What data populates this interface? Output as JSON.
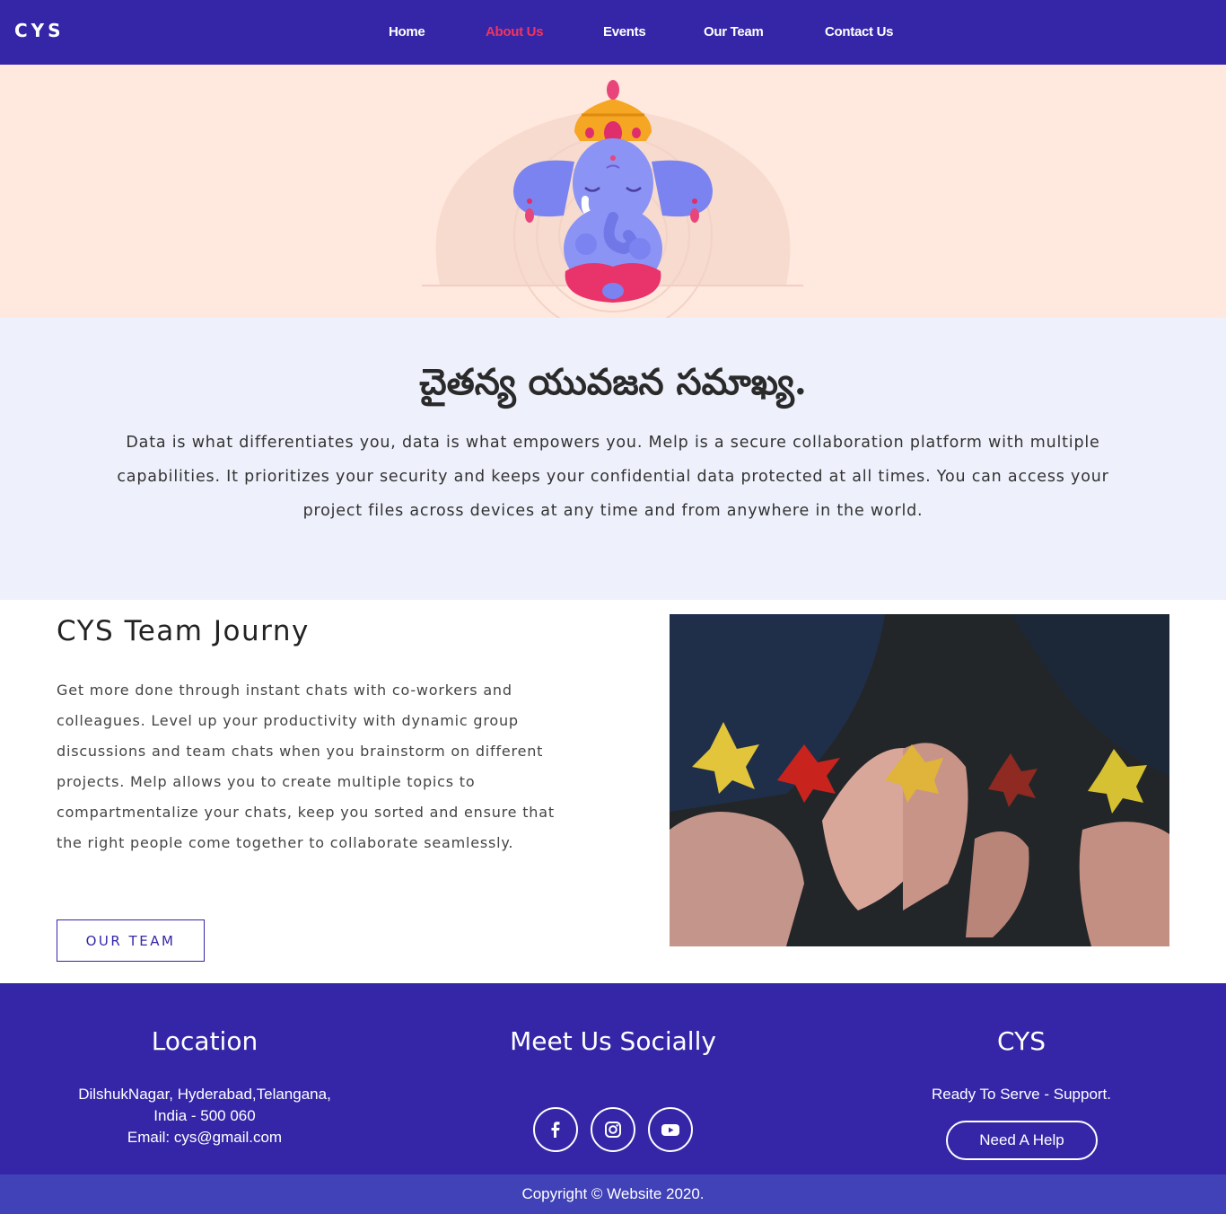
{
  "navbar": {
    "brand": "CYS",
    "links": [
      {
        "label": "Home",
        "active": false
      },
      {
        "label": "About Us",
        "active": true
      },
      {
        "label": "Events",
        "active": false
      },
      {
        "label": "Our Team",
        "active": false
      },
      {
        "label": "Contact Us",
        "active": false
      }
    ],
    "active_color": "#f0355c"
  },
  "hero": {
    "illustration": "meditating-ganesha-illustration"
  },
  "intro": {
    "title": "చైతన్య యువజన సమాఖ్య.",
    "text": "Data is what differentiates you, data is what empowers you. Melp is a secure collaboration platform with multiple capabilities. It prioritizes your security and keeps your confidential data protected at all times. You can access your project files across devices at any time and from anywhere in the world."
  },
  "journey": {
    "title": "CYS Team Journy",
    "text": "Get more done through instant chats with co-workers and colleagues. Level up your productivity with dynamic group discussions and team chats when you brainstorm on different projects. Melp allows you to create multiple topics to compartmentalize your chats, keep you sorted and ensure that the right people come together to collaborate seamlessly.",
    "button_label": "OUR TEAM",
    "photo": "hands-holding-autumn-leaves-photo"
  },
  "footer": {
    "location": {
      "heading": "Location",
      "line1": "DilshukNagar, Hyderabad,Telangana,",
      "line2": "India - 500 060",
      "line3": "Email: cys@gmail.com"
    },
    "social": {
      "heading": "Meet Us Socially",
      "icons": [
        "facebook-icon",
        "instagram-icon",
        "youtube-icon"
      ]
    },
    "cys": {
      "heading": "CYS",
      "tagline": "Ready To Serve - Support.",
      "button_label": "Need A Help"
    }
  },
  "copyright": "Copyright © Website 2020.",
  "colors": {
    "primary": "#3526a8",
    "accent": "#f0355c",
    "hero_bg": "#ffe8de",
    "intro_bg": "#eef0fb",
    "copyright_bg": "#4141b8"
  }
}
